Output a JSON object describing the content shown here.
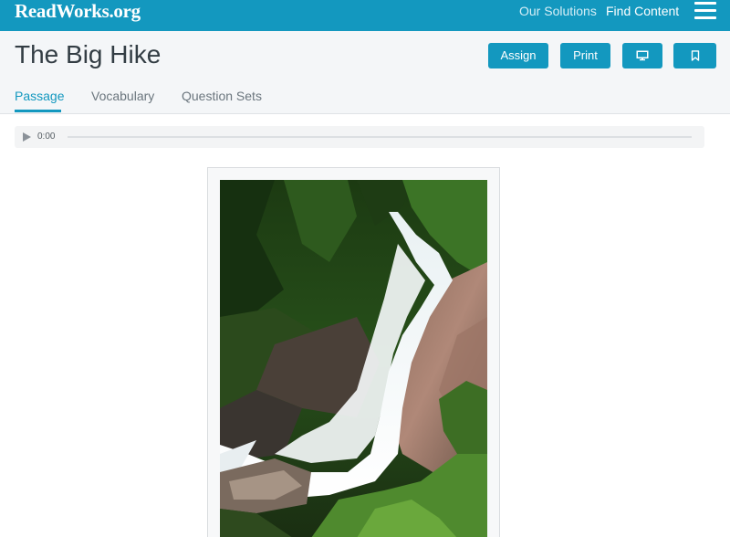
{
  "topbar": {
    "logo": "ReadWorks.org",
    "nav": {
      "solutions": "Our Solutions",
      "find_content": "Find Content"
    },
    "menu_icon": "hamburger-menu-icon"
  },
  "header": {
    "title": "The Big Hike",
    "buttons": {
      "assign": "Assign",
      "print": "Print",
      "present_icon": "monitor-icon",
      "save_icon": "bookmark-icon"
    },
    "tabs": {
      "passage": "Passage",
      "vocabulary": "Vocabulary",
      "question_sets": "Question Sets"
    },
    "active_tab": "Passage"
  },
  "audio": {
    "time": "0:00",
    "play_icon": "play-icon",
    "progress": 0
  },
  "figure": {
    "image": "waterfall-photo"
  },
  "colors": {
    "brand": "#1398bf",
    "header_bg": "#f4f6f8",
    "text_dark": "#333d44",
    "tab_inactive": "#6b767e"
  }
}
